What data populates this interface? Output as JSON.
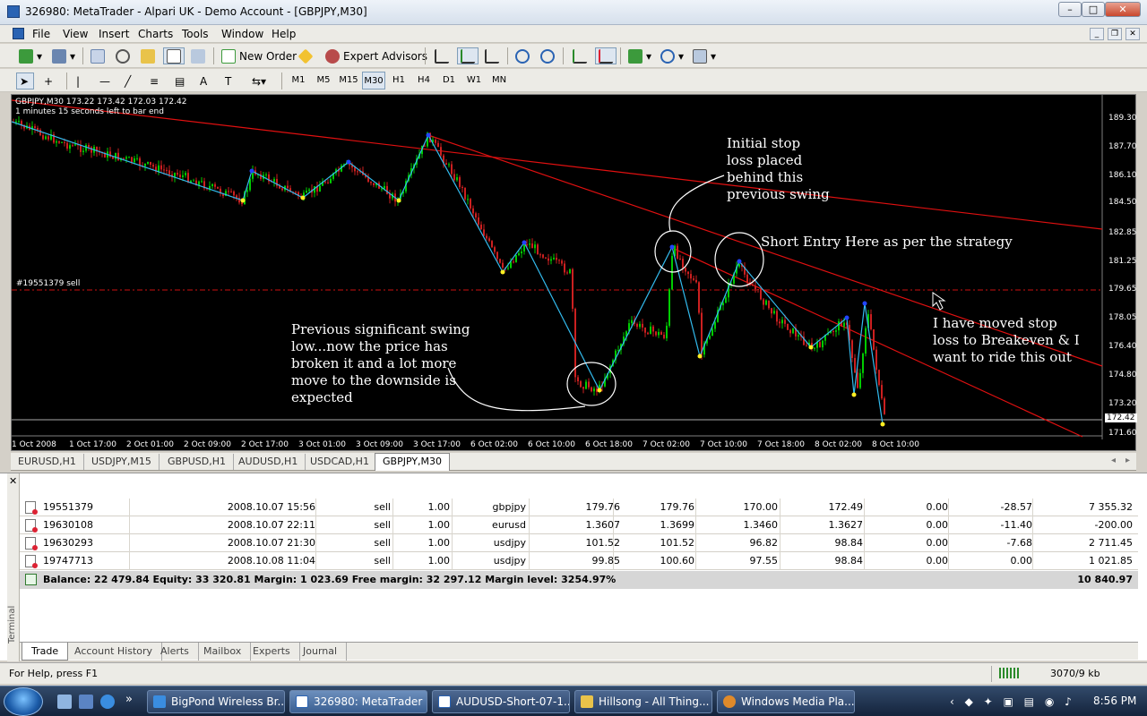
{
  "window": {
    "title": "326980: MetaTrader - Alpari UK - Demo Account - [GBPJPY,M30]"
  },
  "menu": [
    "File",
    "View",
    "Insert",
    "Charts",
    "Tools",
    "Window",
    "Help"
  ],
  "toolbar1": {
    "new_order": "New Order",
    "expert_advisors": "Expert Advisors"
  },
  "timeframes": [
    "M1",
    "M5",
    "M15",
    "M30",
    "H1",
    "H4",
    "D1",
    "W1",
    "MN"
  ],
  "chart": {
    "header": "GBPJPY,M30  173.22 173.42 172.03 172.42",
    "bar_timer": "1 minutes 15 seconds left to bar end",
    "order_line": "#19551379 sell",
    "price_labels": [
      "189.30",
      "187.70",
      "186.10",
      "184.50",
      "182.85",
      "181.25",
      "179.65",
      "178.05",
      "176.40",
      "174.80",
      "173.20",
      "172.42",
      "171.60"
    ],
    "time_labels": [
      "1 Oct 2008",
      "1 Oct 17:00",
      "2 Oct 01:00",
      "2 Oct 09:00",
      "2 Oct 17:00",
      "3 Oct 01:00",
      "3 Oct 09:00",
      "3 Oct 17:00",
      "6 Oct 02:00",
      "6 Oct 10:00",
      "6 Oct 18:00",
      "7 Oct 02:00",
      "7 Oct 10:00",
      "7 Oct 18:00",
      "8 Oct 02:00",
      "8 Oct 10:00"
    ],
    "annotations": {
      "stop_loss": [
        "Initial stop",
        "loss placed",
        "behind this",
        "previous swing"
      ],
      "entry": "Short Entry Here as per the strategy",
      "swing": [
        "Previous significant swing",
        "low...now the price has",
        "broken it and a lot more",
        "move to the downside is",
        "expected"
      ],
      "breakeven": [
        "I have moved stop",
        "loss to Breakeven & I",
        "want to ride this out"
      ]
    }
  },
  "symbol_tabs": [
    "EURUSD,H1",
    "USDJPY,M15",
    "GBPUSD,H1",
    "AUDUSD,H1",
    "USDCAD,H1",
    "GBPJPY,M30"
  ],
  "orders": [
    {
      "order": "19551379",
      "time": "2008.10.07 15:56",
      "type": "sell",
      "size": "1.00",
      "symbol": "gbpjpy",
      "price": "179.76",
      "sl": "179.76",
      "tp": "170.00",
      "current": "172.49",
      "commission": "0.00",
      "swap": "-28.57",
      "profit": "7 355.32"
    },
    {
      "order": "19630108",
      "time": "2008.10.07 22:11",
      "type": "sell",
      "size": "1.00",
      "symbol": "eurusd",
      "price": "1.3607",
      "sl": "1.3699",
      "tp": "1.3460",
      "current": "1.3627",
      "commission": "0.00",
      "swap": "-11.40",
      "profit": "-200.00"
    },
    {
      "order": "19630293",
      "time": "2008.10.07 21:30",
      "type": "sell",
      "size": "1.00",
      "symbol": "usdjpy",
      "price": "101.52",
      "sl": "101.52",
      "tp": "96.82",
      "current": "98.84",
      "commission": "0.00",
      "swap": "-7.68",
      "profit": "2 711.45"
    },
    {
      "order": "19747713",
      "time": "2008.10.08 11:04",
      "type": "sell",
      "size": "1.00",
      "symbol": "usdjpy",
      "price": "99.85",
      "sl": "100.60",
      "tp": "97.55",
      "current": "98.84",
      "commission": "0.00",
      "swap": "0.00",
      "profit": "1 021.85"
    }
  ],
  "balance": {
    "text": "Balance: 22 479.84  Equity: 33 320.81  Margin: 1 023.69  Free margin: 32 297.12  Margin level: 3254.97%",
    "total": "10 840.97"
  },
  "terminal_tabs": [
    "Trade",
    "Account History",
    "Alerts",
    "Mailbox",
    "Experts",
    "Journal"
  ],
  "terminal_label": "Terminal",
  "status": {
    "help": "For Help, press F1",
    "traffic": "3070/9 kb"
  },
  "taskbar": {
    "tasks": [
      "BigPond Wireless Br...",
      "326980: MetaTrader ...",
      "AUDUSD-Short-07-1...",
      "Hillsong - All Thing...",
      "Windows Media Pla..."
    ],
    "clock": "8:56 PM"
  },
  "colors": {
    "chart_bg": "#000000",
    "candle_green": "#00cc00",
    "trend_red": "#e01010",
    "zigzag": "#33bbee"
  }
}
